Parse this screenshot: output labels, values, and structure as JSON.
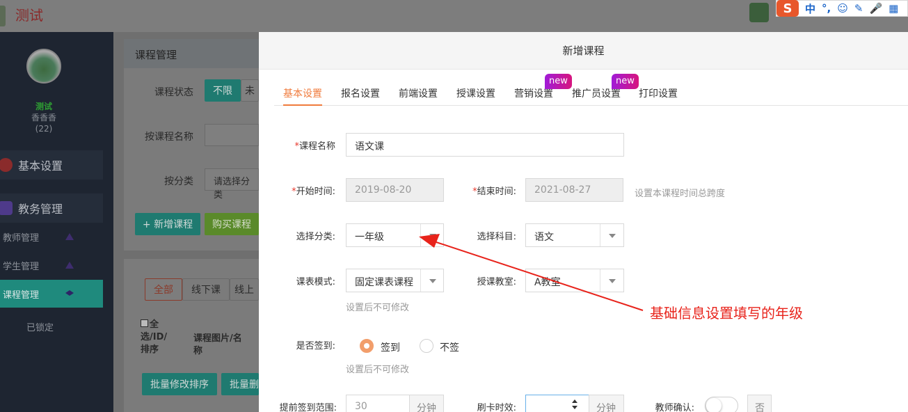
{
  "app": {
    "title": "测试"
  },
  "sidebar": {
    "user_name": "测试",
    "user_nick": "香香香",
    "user_count": "(22)",
    "sections": [
      {
        "label": "基本设置",
        "icon": "gear-icon"
      },
      {
        "label": "教务管理",
        "icon": "database-icon"
      }
    ],
    "items": [
      {
        "label": "教师管理",
        "icon": "teacher-icon"
      },
      {
        "label": "学生管理",
        "icon": "student-icon"
      },
      {
        "label": "课程管理",
        "icon": "graduation-cap-icon"
      }
    ],
    "locked": "已锁定"
  },
  "page": {
    "header": "课程管理",
    "status_label": "课程状态",
    "status_unlimited": "不限",
    "status_next": "未",
    "name_label": "按课程名称",
    "category_label": "按分类",
    "category_placeholder": "请选择分类",
    "add_course": "+ 新增课程",
    "buy_course": "购买课程",
    "filter_all": "全部",
    "filter_offline": "线下课",
    "filter_online": "线上",
    "col_select": "全选/ID/排序",
    "col_image": "课程图片/名称",
    "batch_sort": "批量修改排序",
    "batch_delete": "批量删"
  },
  "modal": {
    "title": "新增课程",
    "tabs": [
      {
        "label": "基本设置",
        "active": true,
        "badge": ""
      },
      {
        "label": "报名设置",
        "active": false,
        "badge": ""
      },
      {
        "label": "前端设置",
        "active": false,
        "badge": ""
      },
      {
        "label": "授课设置",
        "active": false,
        "badge": ""
      },
      {
        "label": "营销设置",
        "active": false,
        "badge": "new"
      },
      {
        "label": "推广员设置",
        "active": false,
        "badge": "new"
      },
      {
        "label": "打印设置",
        "active": false,
        "badge": ""
      }
    ],
    "form": {
      "course_name_label": "课程名称",
      "course_name_value": "语文课",
      "start_label": "开始时间:",
      "start_value": "2019-08-20",
      "end_label": "结束时间:",
      "end_value": "2021-08-27",
      "time_hint": "设置本课程时间总跨度",
      "category_label": "选择分类:",
      "category_value": "一年级",
      "subject_label": "选择科目:",
      "subject_value": "语文",
      "schedule_label": "课表模式:",
      "schedule_value": "固定课表课程",
      "classroom_label": "授课教室:",
      "classroom_value": "A教室",
      "schedule_hint": "设置后不可修改",
      "checkin_label": "是否签到:",
      "checkin_yes": "签到",
      "checkin_no": "不签",
      "checkin_hint": "设置后不可修改",
      "early_label": "提前签到范围:",
      "early_value": "30",
      "early_unit": "分钟",
      "card_label": "刷卡时效:",
      "card_value": "",
      "card_unit": "分钟",
      "teacher_confirm_label": "教师确认:",
      "teacher_confirm_value": "否"
    }
  },
  "annotation": {
    "text": "基础信息设置填写的年级",
    "color": "#e8231b"
  },
  "ime": {
    "items": [
      "中",
      "°,",
      "☺",
      "✎",
      "🎤",
      "▦"
    ]
  }
}
